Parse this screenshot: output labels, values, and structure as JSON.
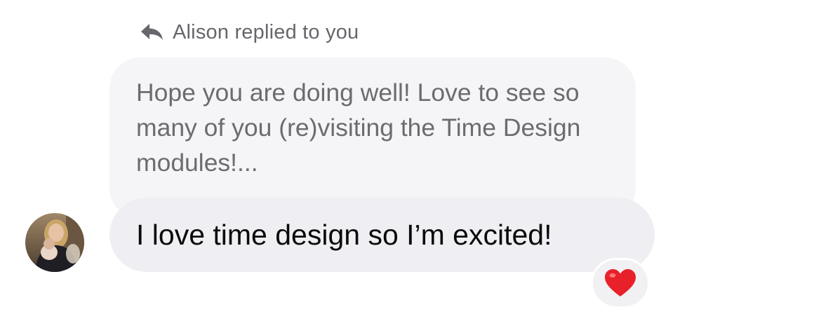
{
  "reply_header": {
    "icon": "reply-arrow-icon",
    "text": "Alison replied to you"
  },
  "quoted_message": {
    "text": "Hope you are doing well! Love to see so many of you (re)visiting the Time Design modules!..."
  },
  "reply_message": {
    "text": "I love time design so I’m excited!"
  },
  "avatar": {
    "icon": "user-avatar-photo"
  },
  "reaction": {
    "icon": "red-heart-icon",
    "color": "#e8202a"
  }
}
